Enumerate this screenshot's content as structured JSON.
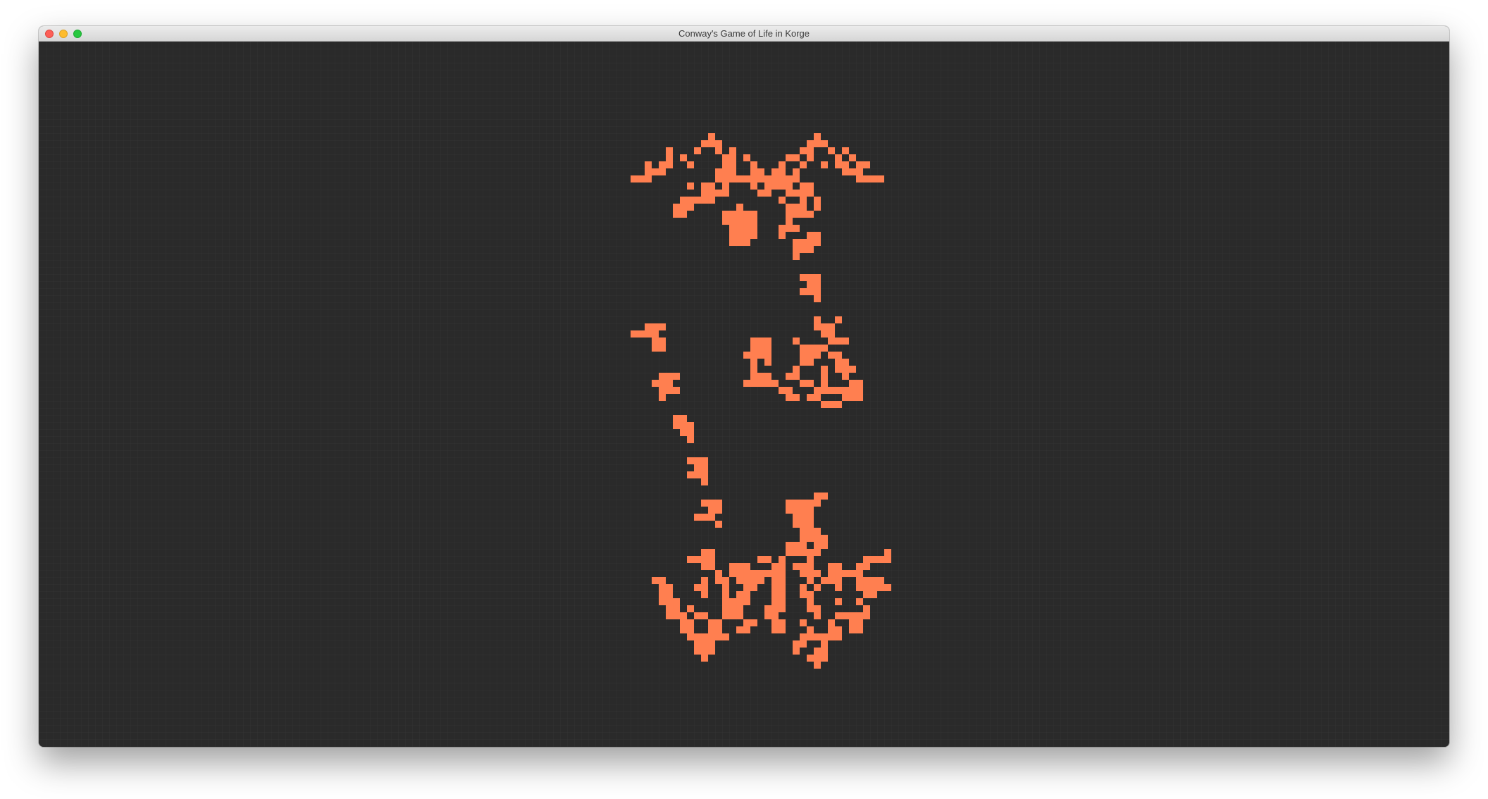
{
  "window": {
    "title": "Conway's Game of Life in Korge"
  },
  "board": {
    "cell_color": "#ff7f50",
    "background_color": "#2a2a2a",
    "grid_line_color": "#333333",
    "live_cells_grid": [
      "...........X..............X..........",
      "..........XXX............XXX.........",
      ".....X...X..X.X.........XX..X.X......",
      ".....X.X.....XX.X.....XX.X...X.X.....",
      "..X.XX..X....XX..X...X..X..X.XX.XX...",
      "..XXX.......XXX..XX.XX.X......XXX....",
      "XXX.........XXXXXXXXXXXX........XXXX.",
      "........X.XX.X...X.XXXX.XX...........",
      "..........XXXX....XX..XXXX...........",
      ".......XXXXX.........X..X.X..........",
      "......XXX......X......XXX.X..........",
      "......XX.....XXXXX....XXXX...........",
      ".............XXXXX....X..............",
      "..............XXXX...XXX.............",
      "..............XXXX...X...XX..........",
      "..............XXX......XXXX..........",
      ".......................XXX...........",
      ".......................X.............",
      ".....................................",
      ".....................................",
      "........................XXX..........",
      ".........................XX..........",
      "........................XXX..........",
      "..........................X..........",
      ".....................................",
      ".....................................",
      "..........................X..X.......",
      "..XXX.....................XXX........",
      "XXXX.......................XX........",
      "...XX............XXX...X....XXX......",
      "...XX............XXX....XXXX.........",
      "................XXXX....XXX.XX.......",
      ".................X.X....XX...XX......",
      ".................X.....X...X.XXX.....",
      "....XXX..........XXX..XX...X..X......",
      "...XXX..........XXXXX...XX.X...XX....",
      "....XXX..............XX...XXXXXXX....",
      "....X.................XX.XX...XXX....",
      "...........................XXX.......",
      ".....................................",
      "......XX.............................",
      "......XXX............................",
      ".......XX............................",
      "........X............................",
      ".....................................",
      ".....................................",
      "........XXX..........................",
      ".........XX..........................",
      "........XXX..........................",
      "..........X..........................",
      ".....................................",
      "..........................XX.........",
      "..........XXX.........XXXXX..........",
      "...........XX.........XXXX...........",
      ".........XXX...........XXX...........",
      "............X..........XXX...........",
      "........................XXX..........",
      "........................XXXX.........",
      "......................XXX.XX.........",
      "..........XX..........XXXXX.........X",
      "........XXXX......XX.X...X.......XXXX",
      "..........XX..XXX...XX.XXX..XX..XX...",
      "............X.XXXXXXXX..XXX.XXXXX....",
      "...XX.....X.XX.XXXX.XX...X.XXX..XXXX.",
      "....XX...XX..X..XX..XX..X.X..X..XXXXX",
      "....XX....X..X.XX...XX..XX.......XX..",
      "....XXX......XXXX...XX...X...X..X....",
      ".....XX.X....XXX...XXX...XX......X...",
      ".....XXX.XX..XXX...XX.....X..XXXXX...",
      ".......XX..XX...XX..XX..X...X..XX....",
      ".......XX..XX..XX...XX...X..XX.XX....",
      "........XXXXXX..........XXXXXX.......",
      ".........XXX...........XX..X.........",
      ".........XXX...........X..XX.........",
      "..........X..............XXX.........",
      "..........................X.........."
    ]
  }
}
